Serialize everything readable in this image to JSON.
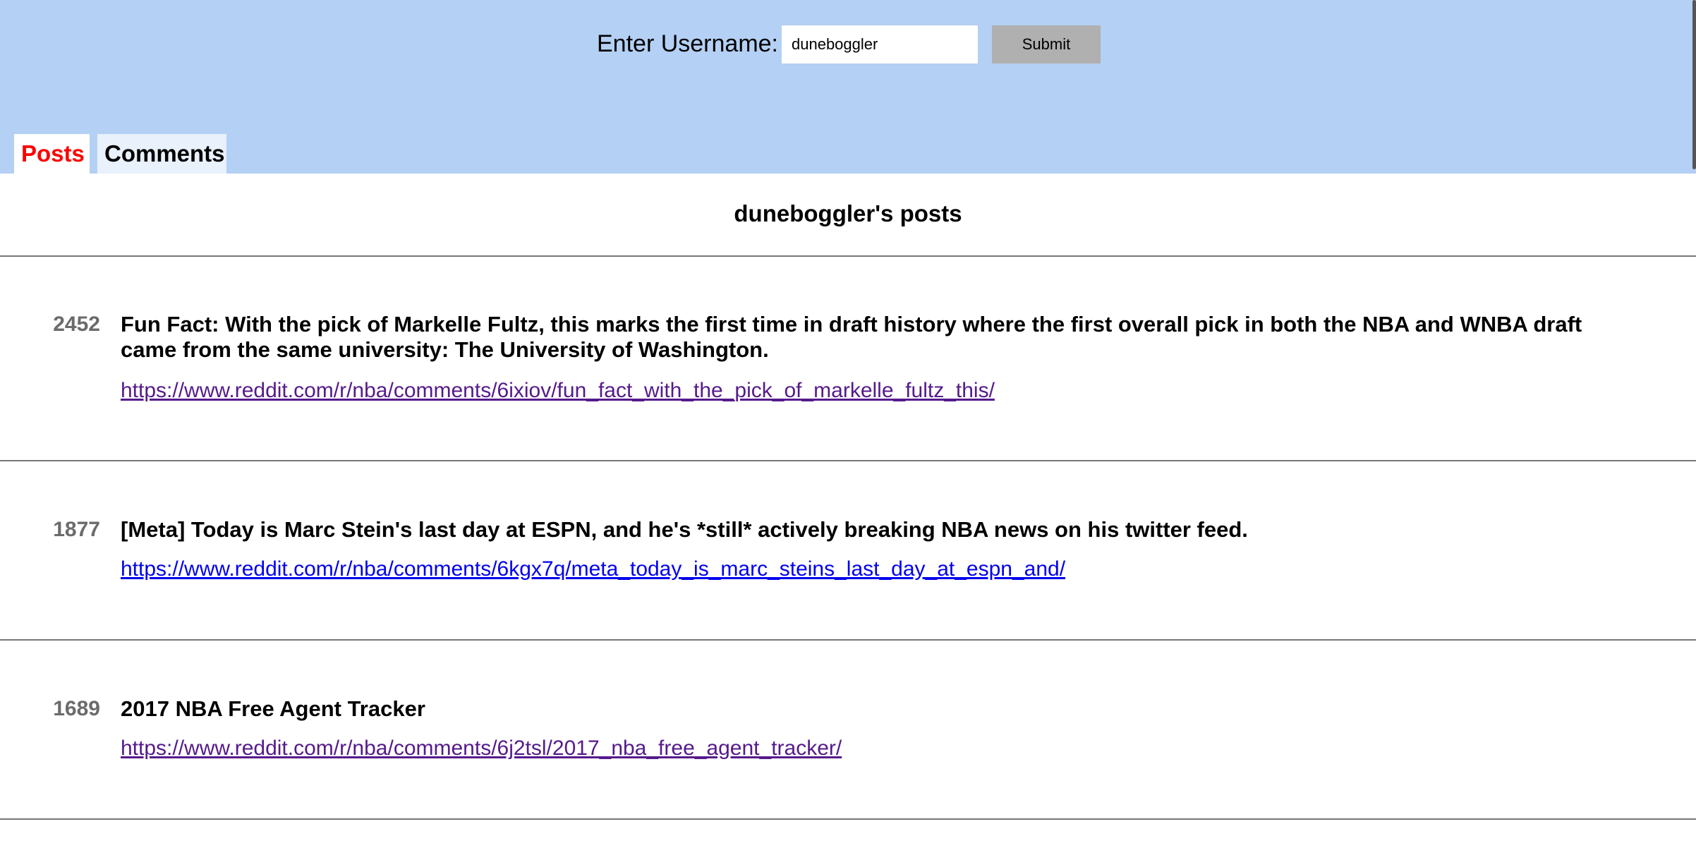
{
  "form": {
    "label": "Enter Username:",
    "username_value": "duneboggler",
    "submit_label": "Submit"
  },
  "tabs": [
    {
      "label": "Posts",
      "active": true,
      "color": "#ff0000"
    },
    {
      "label": "Comments",
      "active": false
    }
  ],
  "page_title": "duneboggler's posts",
  "colors": {
    "header_bg": "#b4d0f4",
    "link_visited": "#551a8b",
    "link_unvisited": "#0000ee",
    "score_gray": "#6b6b6b"
  },
  "posts": [
    {
      "score": "2452",
      "title": "Fun Fact: With the pick of Markelle Fultz, this marks the first time in draft history where the first overall pick in both the NBA and WNBA draft came from the same university: The University of Washington.",
      "url": "https://www.reddit.com/r/nba/comments/6ixiov/fun_fact_with_the_pick_of_markelle_fultz_this/",
      "visited": true
    },
    {
      "score": "1877",
      "title": "[Meta] Today is Marc Stein's last day at ESPN, and he's *still* actively breaking NBA news on his twitter feed.",
      "url": "https://www.reddit.com/r/nba/comments/6kgx7q/meta_today_is_marc_steins_last_day_at_espn_and/",
      "visited": false
    },
    {
      "score": "1689",
      "title": "2017 NBA Free Agent Tracker",
      "url": "https://www.reddit.com/r/nba/comments/6j2tsl/2017_nba_free_agent_tracker/",
      "visited": true
    }
  ]
}
